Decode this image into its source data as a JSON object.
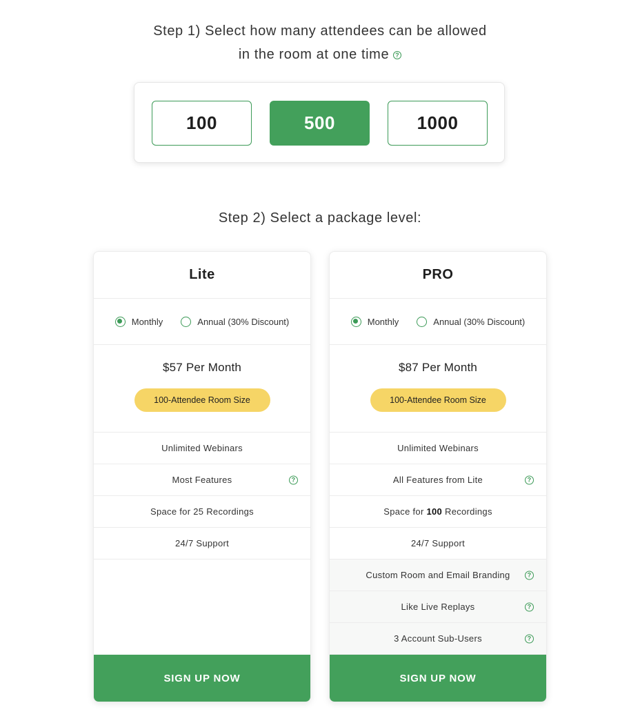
{
  "step1": {
    "title_line1": "Step 1) Select how many attendees can be allowed",
    "title_line2": "in the room at one time",
    "help_glyph": "?",
    "options": [
      "100",
      "500",
      "1000"
    ],
    "selected": "500"
  },
  "step2": {
    "title": "Step 2) Select a package level:"
  },
  "accent_color": "#43a05b",
  "badge_color": "#f6d566",
  "plans": {
    "lite": {
      "name": "Lite",
      "billing_monthly": "Monthly",
      "billing_annual": "Annual (30% Discount)",
      "billing_selected": "Monthly",
      "price": "$57 Per Month",
      "room_size": "100-Attendee Room Size",
      "features": [
        {
          "text": "Unlimited Webinars"
        },
        {
          "text": "Most Features",
          "help": "?"
        },
        {
          "text": "Space for 25 Recordings"
        },
        {
          "text": "24/7 Support"
        }
      ],
      "cta": "SIGN UP NOW"
    },
    "pro": {
      "name": "PRO",
      "billing_monthly": "Monthly",
      "billing_annual": "Annual (30% Discount)",
      "billing_selected": "Monthly",
      "price": "$87 Per Month",
      "room_size": "100-Attendee Room Size",
      "features": [
        {
          "text": "Unlimited Webinars"
        },
        {
          "text": "All Features from Lite",
          "help": "?"
        },
        {
          "text_prefix": "Space for ",
          "text_bold": "100",
          "text_suffix": " Recordings"
        },
        {
          "text": "24/7 Support"
        },
        {
          "text": "Custom Room and Email Branding",
          "help": "?"
        },
        {
          "text": "Like Live Replays",
          "help": "?"
        },
        {
          "text": "3 Account Sub-Users",
          "help": "?"
        }
      ],
      "cta": "SIGN UP NOW"
    }
  }
}
